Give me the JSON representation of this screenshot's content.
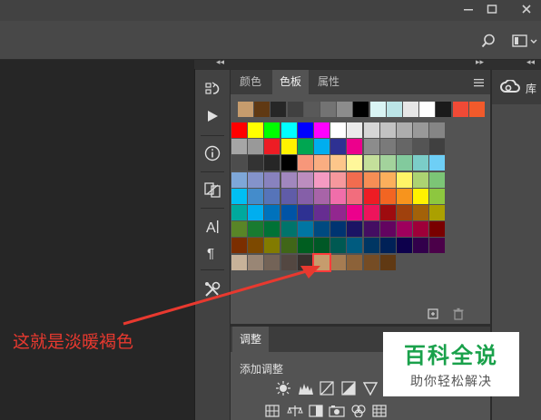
{
  "window": {
    "buttons": [
      "—",
      "▢",
      "✕"
    ]
  },
  "panel": {
    "tabs": [
      {
        "label": "颜色",
        "active": false
      },
      {
        "label": "色板",
        "active": true
      },
      {
        "label": "属性",
        "active": false
      }
    ]
  },
  "library": {
    "label": "库"
  },
  "adjustments": {
    "tab_label": "调整",
    "add_label": "添加调整"
  },
  "annotation": {
    "text": "这就是淡暖褐色"
  },
  "watermark": {
    "title": "百科全说",
    "subtitle": "助你轻松解决"
  },
  "swatches": {
    "recent": [
      "#c69c6d",
      "#603913",
      "#262626",
      "#404040",
      "#595959",
      "#737373",
      "#8c8c8c",
      "#000000",
      "#d9f4f4",
      "#bbe4e6",
      "#e6e6e6",
      "#ffffff",
      "#1a1a1a",
      "#f04a36",
      "#f15a2b"
    ],
    "rows": [
      [
        "#ff0000",
        "#ffff00",
        "#00ff00",
        "#00ffff",
        "#0000ff",
        "#ff00ff",
        "#ffffff",
        "#ebebeb",
        "#d6d6d6",
        "#c2c2c2",
        "#adadad",
        "#999999",
        "#858585"
      ],
      [
        "#a6a6a6",
        "#999999",
        "#ed1c24",
        "#fff200",
        "#00a651",
        "#00aeef",
        "#2e3192",
        "#ec008c",
        "#8c8c8c",
        "#7a7a7a",
        "#666666",
        "#545454",
        "#404040"
      ],
      [
        "#4d4d4d",
        "#333333",
        "#262626",
        "#000000",
        "#f7977a",
        "#f9ad81",
        "#fdc68a",
        "#fff79a",
        "#c4df9b",
        "#a3d39c",
        "#82ca9d",
        "#7bcdc8",
        "#6ecff6"
      ],
      [
        "#7ea7d8",
        "#8493ca",
        "#8882be",
        "#a187be",
        "#bc8dbf",
        "#f49ac2",
        "#f6989d",
        "#f26c4f",
        "#f68e55",
        "#fbaf5c",
        "#fff467",
        "#acd372",
        "#7cc576"
      ],
      [
        "#00bff3",
        "#448ccb",
        "#5674b9",
        "#605ca8",
        "#855fa8",
        "#a864a8",
        "#f06eaa",
        "#f26d7d",
        "#ed1c24",
        "#f26522",
        "#f7941d",
        "#fff200",
        "#8dc73f"
      ],
      [
        "#00a99d",
        "#00aeef",
        "#0072bc",
        "#0054a6",
        "#2e3192",
        "#662d91",
        "#92278f",
        "#ec008c",
        "#ed145b",
        "#9e0b0f",
        "#a0410d",
        "#a36209",
        "#aba000"
      ],
      [
        "#598527",
        "#197b30",
        "#007236",
        "#00746b",
        "#0076a3",
        "#004a80",
        "#003471",
        "#1b1464",
        "#440e62",
        "#630460",
        "#9e005d",
        "#9e0039",
        "#790000"
      ],
      [
        "#7b2e00",
        "#7d4900",
        "#827b00",
        "#406618",
        "#005e20",
        "#005826",
        "#005952",
        "#005b7f",
        "#003663",
        "#002157",
        "#0d004c",
        "#32004b",
        "#4b0049"
      ],
      [
        "#c7b299",
        "#998675",
        "#736357",
        "#534741",
        "#37302d",
        "#c69c6d",
        "#a67c52",
        "#8c6239",
        "#754c24",
        "#603913"
      ]
    ]
  },
  "selected_swatch": {
    "row": 8,
    "col": 5
  }
}
